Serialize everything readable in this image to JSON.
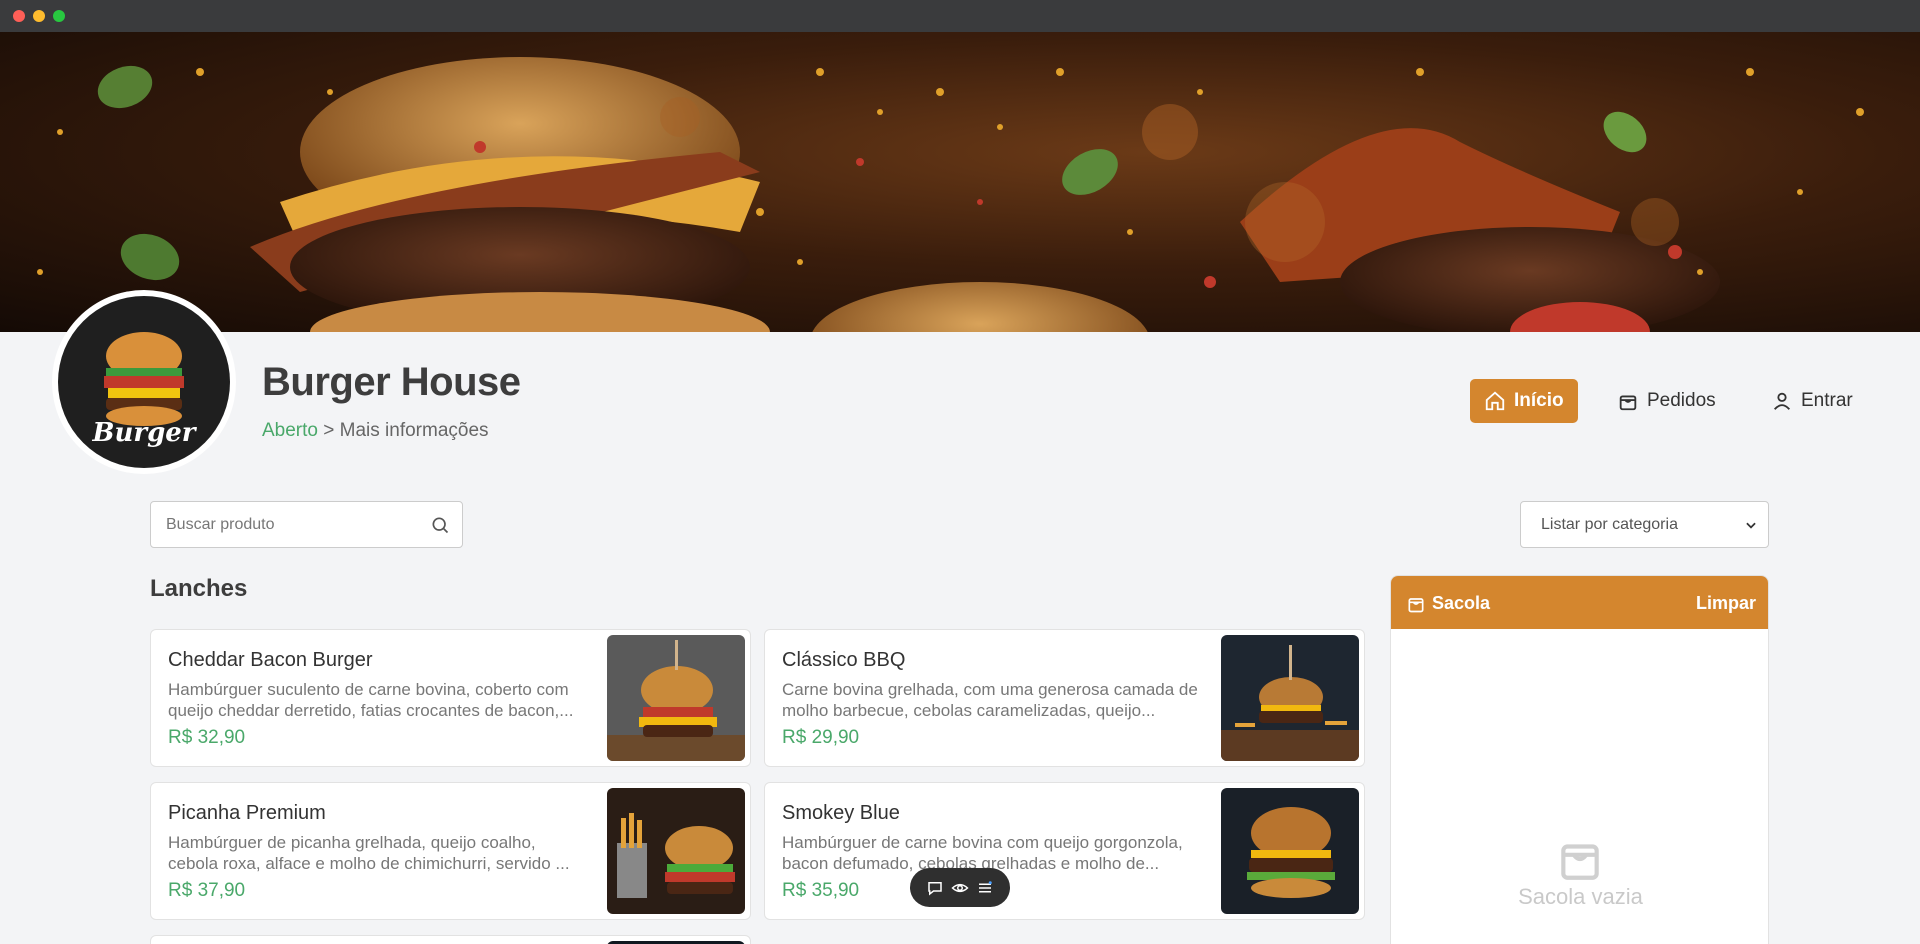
{
  "store": {
    "name": "Burger House",
    "status": "Aberto",
    "separator": " > ",
    "more_info": "Mais informações",
    "logo_text": "Burger"
  },
  "nav": {
    "home": "Início",
    "orders": "Pedidos",
    "login": "Entrar"
  },
  "search": {
    "placeholder": "Buscar produto"
  },
  "filter": {
    "selected": "Listar por categoria"
  },
  "section": {
    "title": "Lanches"
  },
  "products": [
    {
      "name": "Cheddar Bacon Burger",
      "description": "Hambúrguer suculento de carne bovina, coberto com queijo cheddar derretido, fatias crocantes de bacon,...",
      "price": "R$ 32,90"
    },
    {
      "name": "Clássico BBQ",
      "description": "Carne bovina grelhada, com uma generosa camada de molho barbecue, cebolas caramelizadas, queijo...",
      "price": "R$ 29,90"
    },
    {
      "name": "Picanha Premium",
      "description": "Hambúrguer de picanha grelhada, queijo coalho, cebola roxa, alface e molho de chimichurri, servido ...",
      "price": "R$ 37,90"
    },
    {
      "name": "Smokey Blue",
      "description": "Hambúrguer de carne bovina com queijo gorgonzola, bacon defumado, cebolas grelhadas e molho de...",
      "price": "R$ 35,90"
    }
  ],
  "cart": {
    "title": "Sacola",
    "clear": "Limpar",
    "empty": "Sacola vazia"
  },
  "colors": {
    "accent": "#d4862e",
    "success": "#4aa86a",
    "background": "#f3f4f6"
  }
}
